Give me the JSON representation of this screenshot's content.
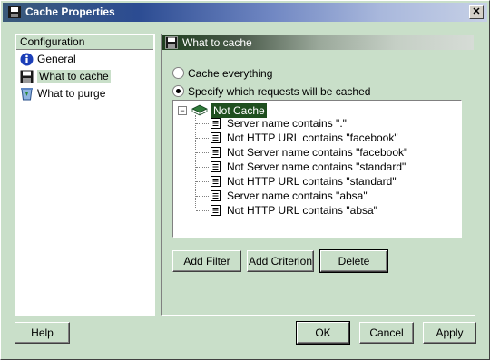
{
  "window": {
    "title": "Cache Properties",
    "close_glyph": "✕"
  },
  "sidebar": {
    "header": "Configuration",
    "items": [
      {
        "label": "General",
        "icon": "info-icon"
      },
      {
        "label": "What to cache",
        "icon": "floppy-disk-icon",
        "selected": true
      },
      {
        "label": "What to purge",
        "icon": "recycle-bin-icon"
      }
    ]
  },
  "panel": {
    "title": "What to cache",
    "radio_cache_everything": "Cache everything",
    "radio_specify": "Specify which requests will be cached",
    "selected_radio": "specify"
  },
  "tree": {
    "expand_glyph": "−",
    "root": "Not Cache",
    "items": [
      "Server name contains \".\"",
      "Not HTTP URL contains \"facebook\"",
      "Not Server name contains \"facebook\"",
      "Not Server name contains \"standard\"",
      "Not HTTP URL contains \"standard\"",
      "Server name contains \"absa\"",
      "Not HTTP URL contains \"absa\""
    ]
  },
  "buttons": {
    "add_filter": "Add Filter",
    "add_criterion": "Add Criterion",
    "delete": "Delete",
    "help": "Help",
    "ok": "OK",
    "cancel": "Cancel",
    "apply": "Apply"
  },
  "colors": {
    "dialog_background": "#c9dfc9",
    "selection": "#1f4f1f",
    "title_gradient_start": "#2c4c92"
  }
}
